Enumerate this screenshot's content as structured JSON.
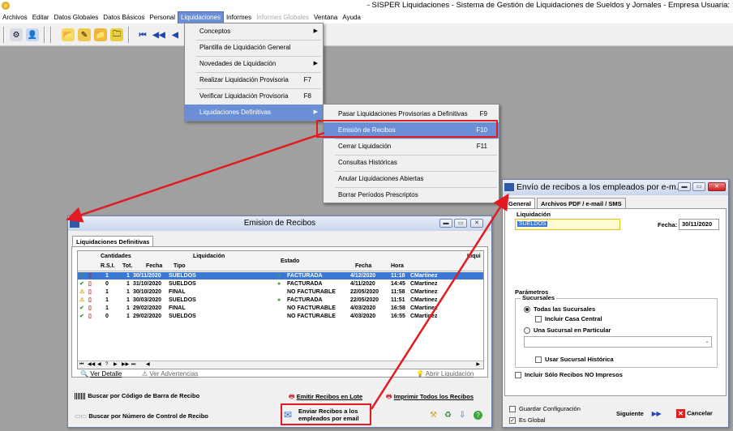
{
  "app": {
    "title": "- SISPER Liquidaciones - Sistema de Gestión de Liquidaciones de Sueldos y Jornales - Empresa Usuaria:"
  },
  "menubar": [
    "Archivos",
    "Editar",
    "Datos Globales",
    "Datos Básicos",
    "Personal",
    "Liquidaciones",
    "Informes",
    "Informes Globales",
    "Ventana",
    "Ayuda"
  ],
  "liq_menu": {
    "items": [
      {
        "label": "Conceptos",
        "shortcut": ""
      },
      {
        "label": "Plantilla de Liquidación General",
        "shortcut": ""
      },
      {
        "label": "Novedades de Liquidación",
        "shortcut": ""
      },
      {
        "label": "Realizar Liquidación Provisoria",
        "shortcut": "F7"
      },
      {
        "label": "Verificar Liquidación Provisoria",
        "shortcut": "F8"
      },
      {
        "label": "Liquidaciones Definitivas",
        "shortcut": ""
      }
    ]
  },
  "def_menu": {
    "items": [
      {
        "label": "Pasar Liquidaciones Provisorias a Definitivas",
        "shortcut": "F9"
      },
      {
        "label": "Emisión de Recibos",
        "shortcut": "F10"
      },
      {
        "label": "Cerrar Liquidación",
        "shortcut": "F11"
      },
      {
        "label": "Consultas Históricas",
        "shortcut": ""
      },
      {
        "label": "Anular Liquidaciones Abiertas",
        "shortcut": ""
      },
      {
        "label": "Borrar Períodos Prescriptos",
        "shortcut": ""
      }
    ]
  },
  "emision": {
    "title": "Emision de Recibos",
    "tab": "Liquidaciones Definitivas",
    "headers": {
      "cantidades": "Cantidades",
      "liquidacion": "Liquidación",
      "estado": "Estado",
      "liqui": "Liqui",
      "rsi": "R.S.I.",
      "tot": "Tot.",
      "fecha": "Fecha",
      "tipo": "Tipo",
      "fecha2": "Fecha",
      "hora": "Hora"
    },
    "rows": [
      {
        "rsi": "1",
        "tot": "1",
        "fecha": "30/11/2020",
        "tipo": "SUELDOS",
        "estado": "FACTURADA",
        "fecha2": "4/12/2020",
        "hora": "11:18",
        "user": "CMartinez",
        "status": "ok",
        "sel": true
      },
      {
        "rsi": "0",
        "tot": "1",
        "fecha": "31/10/2020",
        "tipo": "SUELDOS",
        "estado": "FACTURADA",
        "fecha2": "4/11/2020",
        "hora": "14:45",
        "user": "CMartinez",
        "status": "ok",
        "sel": false
      },
      {
        "rsi": "1",
        "tot": "1",
        "fecha": "30/10/2020",
        "tipo": "FINAL",
        "estado": "NO FACTURABLE",
        "fecha2": "22/05/2020",
        "hora": "11:58",
        "user": "CMartinez",
        "status": "warn",
        "sel": false
      },
      {
        "rsi": "1",
        "tot": "1",
        "fecha": "30/03/2020",
        "tipo": "SUELDOS",
        "estado": "FACTURADA",
        "fecha2": "22/05/2020",
        "hora": "11:51",
        "user": "CMartinez",
        "status": "warn",
        "sel": false
      },
      {
        "rsi": "1",
        "tot": "1",
        "fecha": "29/02/2020",
        "tipo": "FINAL",
        "estado": "NO FACTURABLE",
        "fecha2": "4/03/2020",
        "hora": "16:58",
        "user": "CMartinez",
        "status": "ok",
        "sel": false
      },
      {
        "rsi": "0",
        "tot": "1",
        "fecha": "29/02/2020",
        "tipo": "SUELDOS",
        "estado": "NO FACTURABLE",
        "fecha2": "4/03/2020",
        "hora": "16:55",
        "user": "CMartinez",
        "status": "ok",
        "sel": false
      }
    ],
    "ver_detalle": "Ver Detalle",
    "ver_advertencias": "Ver Advertencias",
    "abrir_liquidacion": "Abrir Liquidación",
    "buscar_barra": "Buscar por Código de Barra de Recibo",
    "buscar_control": "Buscar por Número de Control de Recibo",
    "emitir_lote": "Emitir Recibos en Lote",
    "imprimir_todos": "Imprimir Todos los Recibos",
    "enviar_email": "Enviar Recibos a los empleados por email"
  },
  "envio": {
    "title": "Envío de recibos a los empleados por e-m...",
    "tabs": [
      "General",
      "Archivos PDF / e-mail / SMS"
    ],
    "liquidacion_label": "Liquidación",
    "liquidacion_value": "SUELDOS",
    "fecha_label": "Fecha:",
    "fecha_value": "30/11/2020",
    "parametros": "Parámetros",
    "sucursales": "Sucursales",
    "todas": "Todas las Sucursales",
    "incluir_central": "Incluir Casa Central",
    "una": "Una Sucursal en Particular",
    "historica": "Usar Sucursal Histórica",
    "no_impresos": "Incluir Sólo Recibos NO Impresos",
    "guardar": "Guardar Configuración",
    "es_global": "Es Global",
    "siguiente": "Siguiente",
    "cancelar": "Cancelar"
  },
  "colors": {
    "accent": "#6b8fd6",
    "selection": "#3b78d6",
    "highlight_box": "#e21b22"
  }
}
